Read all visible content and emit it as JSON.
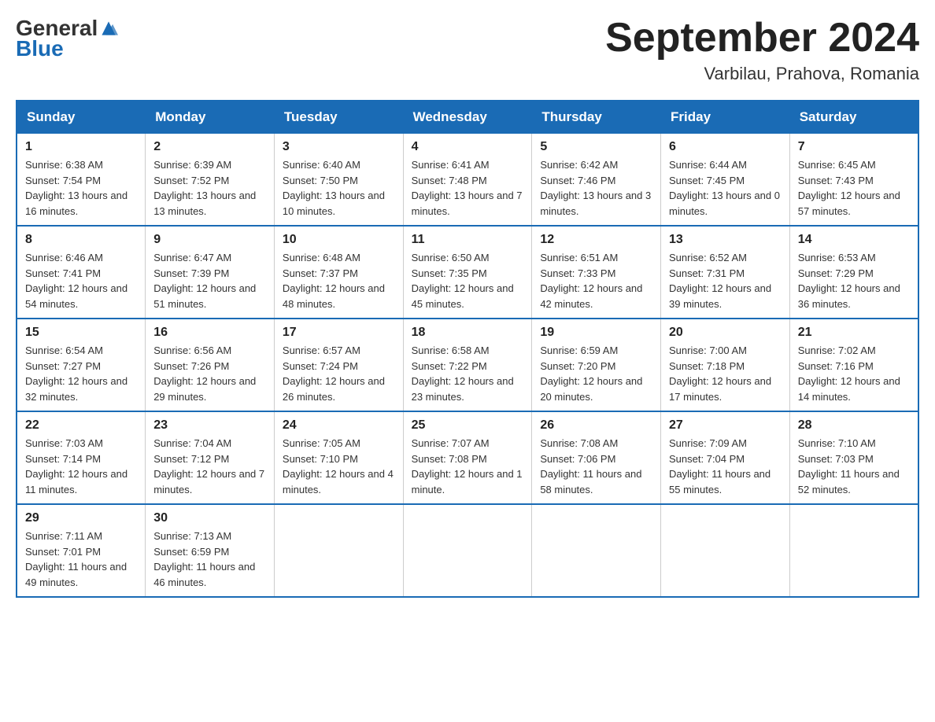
{
  "logo": {
    "general": "General",
    "blue": "Blue"
  },
  "title": {
    "month_year": "September 2024",
    "location": "Varbilau, Prahova, Romania"
  },
  "days_header": [
    "Sunday",
    "Monday",
    "Tuesday",
    "Wednesday",
    "Thursday",
    "Friday",
    "Saturday"
  ],
  "weeks": [
    [
      {
        "day": "1",
        "sunrise": "6:38 AM",
        "sunset": "7:54 PM",
        "daylight": "13 hours and 16 minutes."
      },
      {
        "day": "2",
        "sunrise": "6:39 AM",
        "sunset": "7:52 PM",
        "daylight": "13 hours and 13 minutes."
      },
      {
        "day": "3",
        "sunrise": "6:40 AM",
        "sunset": "7:50 PM",
        "daylight": "13 hours and 10 minutes."
      },
      {
        "day": "4",
        "sunrise": "6:41 AM",
        "sunset": "7:48 PM",
        "daylight": "13 hours and 7 minutes."
      },
      {
        "day": "5",
        "sunrise": "6:42 AM",
        "sunset": "7:46 PM",
        "daylight": "13 hours and 3 minutes."
      },
      {
        "day": "6",
        "sunrise": "6:44 AM",
        "sunset": "7:45 PM",
        "daylight": "13 hours and 0 minutes."
      },
      {
        "day": "7",
        "sunrise": "6:45 AM",
        "sunset": "7:43 PM",
        "daylight": "12 hours and 57 minutes."
      }
    ],
    [
      {
        "day": "8",
        "sunrise": "6:46 AM",
        "sunset": "7:41 PM",
        "daylight": "12 hours and 54 minutes."
      },
      {
        "day": "9",
        "sunrise": "6:47 AM",
        "sunset": "7:39 PM",
        "daylight": "12 hours and 51 minutes."
      },
      {
        "day": "10",
        "sunrise": "6:48 AM",
        "sunset": "7:37 PM",
        "daylight": "12 hours and 48 minutes."
      },
      {
        "day": "11",
        "sunrise": "6:50 AM",
        "sunset": "7:35 PM",
        "daylight": "12 hours and 45 minutes."
      },
      {
        "day": "12",
        "sunrise": "6:51 AM",
        "sunset": "7:33 PM",
        "daylight": "12 hours and 42 minutes."
      },
      {
        "day": "13",
        "sunrise": "6:52 AM",
        "sunset": "7:31 PM",
        "daylight": "12 hours and 39 minutes."
      },
      {
        "day": "14",
        "sunrise": "6:53 AM",
        "sunset": "7:29 PM",
        "daylight": "12 hours and 36 minutes."
      }
    ],
    [
      {
        "day": "15",
        "sunrise": "6:54 AM",
        "sunset": "7:27 PM",
        "daylight": "12 hours and 32 minutes."
      },
      {
        "day": "16",
        "sunrise": "6:56 AM",
        "sunset": "7:26 PM",
        "daylight": "12 hours and 29 minutes."
      },
      {
        "day": "17",
        "sunrise": "6:57 AM",
        "sunset": "7:24 PM",
        "daylight": "12 hours and 26 minutes."
      },
      {
        "day": "18",
        "sunrise": "6:58 AM",
        "sunset": "7:22 PM",
        "daylight": "12 hours and 23 minutes."
      },
      {
        "day": "19",
        "sunrise": "6:59 AM",
        "sunset": "7:20 PM",
        "daylight": "12 hours and 20 minutes."
      },
      {
        "day": "20",
        "sunrise": "7:00 AM",
        "sunset": "7:18 PM",
        "daylight": "12 hours and 17 minutes."
      },
      {
        "day": "21",
        "sunrise": "7:02 AM",
        "sunset": "7:16 PM",
        "daylight": "12 hours and 14 minutes."
      }
    ],
    [
      {
        "day": "22",
        "sunrise": "7:03 AM",
        "sunset": "7:14 PM",
        "daylight": "12 hours and 11 minutes."
      },
      {
        "day": "23",
        "sunrise": "7:04 AM",
        "sunset": "7:12 PM",
        "daylight": "12 hours and 7 minutes."
      },
      {
        "day": "24",
        "sunrise": "7:05 AM",
        "sunset": "7:10 PM",
        "daylight": "12 hours and 4 minutes."
      },
      {
        "day": "25",
        "sunrise": "7:07 AM",
        "sunset": "7:08 PM",
        "daylight": "12 hours and 1 minute."
      },
      {
        "day": "26",
        "sunrise": "7:08 AM",
        "sunset": "7:06 PM",
        "daylight": "11 hours and 58 minutes."
      },
      {
        "day": "27",
        "sunrise": "7:09 AM",
        "sunset": "7:04 PM",
        "daylight": "11 hours and 55 minutes."
      },
      {
        "day": "28",
        "sunrise": "7:10 AM",
        "sunset": "7:03 PM",
        "daylight": "11 hours and 52 minutes."
      }
    ],
    [
      {
        "day": "29",
        "sunrise": "7:11 AM",
        "sunset": "7:01 PM",
        "daylight": "11 hours and 49 minutes."
      },
      {
        "day": "30",
        "sunrise": "7:13 AM",
        "sunset": "6:59 PM",
        "daylight": "11 hours and 46 minutes."
      },
      null,
      null,
      null,
      null,
      null
    ]
  ]
}
